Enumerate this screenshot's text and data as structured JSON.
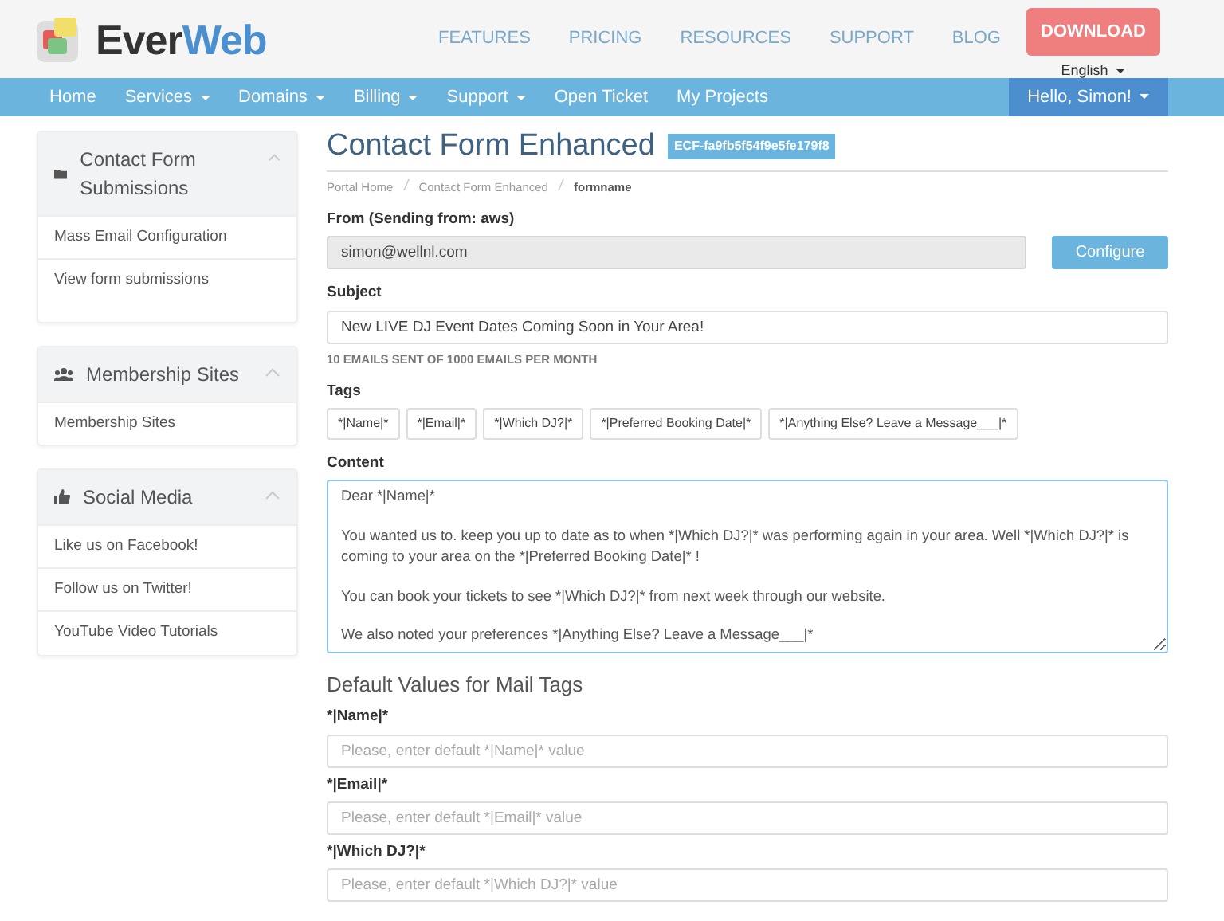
{
  "brand": {
    "part_1": "Ever",
    "part_2": "Web"
  },
  "top_links": [
    {
      "label": "FEATURES"
    },
    {
      "label": "PRICING"
    },
    {
      "label": "RESOURCES"
    },
    {
      "label": "SUPPORT"
    },
    {
      "label": "BLOG"
    }
  ],
  "download_button": "DOWNLOAD",
  "language": {
    "label": "English",
    "dropdown": true
  },
  "nav": [
    {
      "label": "Home",
      "dropdown": false
    },
    {
      "label": "Services",
      "dropdown": true
    },
    {
      "label": "Domains",
      "dropdown": true
    },
    {
      "label": "Billing",
      "dropdown": true
    },
    {
      "label": "Support",
      "dropdown": true
    },
    {
      "label": "Open Ticket",
      "dropdown": false
    },
    {
      "label": "My Projects",
      "dropdown": false
    }
  ],
  "user_menu": {
    "label": "Hello, Simon!",
    "dropdown": true
  },
  "sidebar": [
    {
      "title": "Contact Form Submissions",
      "expanded": true,
      "items": [
        "Mass Email Configuration",
        "View form submissions"
      ]
    },
    {
      "title": "Membership Sites",
      "expanded": true,
      "items": [
        "Membership Sites"
      ]
    },
    {
      "title": "Social Media",
      "expanded": true,
      "items": [
        "Like us on Facebook!",
        "Follow us on Twitter!",
        "YouTube Video Tutorials"
      ]
    }
  ],
  "page": {
    "title": "Contact Form Enhanced",
    "badge": "ECF-fa9fb5f54f9e5fe179f8"
  },
  "breadcrumb": [
    {
      "label": "Portal Home",
      "selected": false
    },
    {
      "label": "Contact Form Enhanced",
      "selected": false
    },
    {
      "label": "formname",
      "selected": true
    }
  ],
  "from": {
    "label": "From (Sending from: aws)",
    "value": "simon@wellnl.com",
    "disabled": true,
    "button": "Configure"
  },
  "subject": {
    "label": "Subject",
    "value": "New LIVE DJ Event Dates Coming Soon in Your Area!",
    "note": "10 EMAILS SENT OF 1000 EMAILS PER MONTH"
  },
  "tags": {
    "label": "Tags",
    "items": [
      "*|Name|*",
      "*|Email|*",
      "*|Which DJ?|*",
      "*|Preferred Booking Date|*",
      "*|Anything Else? Leave a Message___|*"
    ]
  },
  "content": {
    "label": "Content",
    "value": "Dear *|Name|*\n\nYou wanted us to. keep you up to date as to when *|Which DJ?|* was performing again in your area. Well *|Which DJ?|* is coming to your area on the *|Preferred Booking Date|* !\n\nYou can book your tickets to see *|Which DJ?|* from next week through our website.\n\nWe also noted your preferences *|Anything Else? Leave a Message___|*",
    "focused": true
  },
  "defaults": {
    "title": "Default Values for Mail Tags",
    "fields": [
      {
        "label": "*|Name|*",
        "placeholder": "Please, enter default *|Name|* value"
      },
      {
        "label": "*|Email|*",
        "placeholder": "Please, enter default *|Email|* value"
      },
      {
        "label": "*|Which DJ?|*",
        "placeholder": "Please, enter default *|Which DJ?|* value"
      }
    ]
  }
}
